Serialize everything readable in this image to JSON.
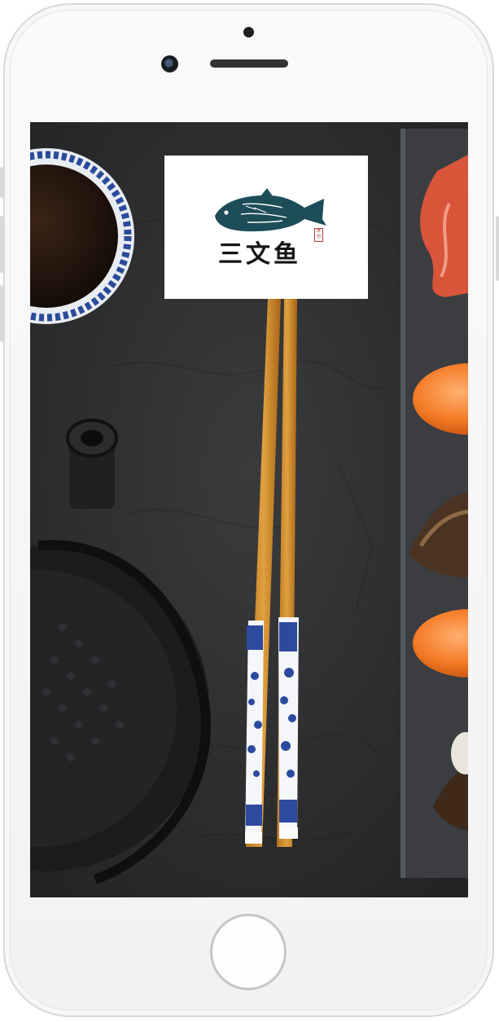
{
  "app": {
    "logo": {
      "text": "三文鱼",
      "seal": "寿司"
    },
    "colors": {
      "fish": "#1d4d58",
      "frame": "#d8d8d8",
      "board": "#333538"
    }
  },
  "device": {
    "speaker_icon": "speaker-grille",
    "camera_icon": "front-camera",
    "home_icon": "home-button"
  }
}
